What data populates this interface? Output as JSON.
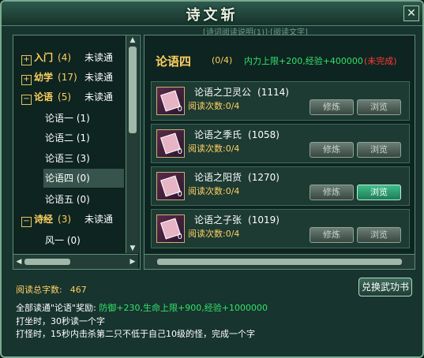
{
  "window": {
    "title": "诗文斩",
    "subtitle": "[诗词阅读说明(1)]·[阅读文字]"
  },
  "left": {
    "categories": [
      {
        "label": "入门",
        "count": "(4)",
        "status": "未读通",
        "expanded": false
      },
      {
        "label": "幼学",
        "count": "(17)",
        "status": "未读通",
        "expanded": false
      },
      {
        "label": "论语",
        "count": "(5)",
        "status": "未读通",
        "expanded": true
      },
      {
        "label": "诗经",
        "count": "(3)",
        "status": "未读通",
        "expanded": true
      }
    ],
    "subitems_lunyu": [
      {
        "label": "论语一",
        "count": "(1)"
      },
      {
        "label": "论语二",
        "count": "(1)"
      },
      {
        "label": "论语三",
        "count": "(3)"
      },
      {
        "label": "论语四",
        "count": "(0)"
      },
      {
        "label": "论语五",
        "count": "(0)"
      }
    ],
    "subitems_shijing": [
      {
        "label": "风一",
        "count": "(0)"
      }
    ]
  },
  "right": {
    "title": "论语四",
    "progress": "(0/4)",
    "reward": "内力上限+200,经验+400000",
    "status": "(未完成)",
    "items": [
      {
        "name": "论语之卫灵公",
        "id": "(1114)",
        "read": "阅读次数:0/4",
        "count": "0",
        "practice": "修炼",
        "browse": "浏览"
      },
      {
        "name": "论语之季氏",
        "id": "(1058)",
        "read": "阅读次数:0/4",
        "count": "0",
        "practice": "修炼",
        "browse": "浏览"
      },
      {
        "name": "论语之阳货",
        "id": "(1270)",
        "read": "阅读次数:0/4",
        "count": "0",
        "practice": "修炼",
        "browse": "浏览"
      },
      {
        "name": "论语之子张",
        "id": "(1019)",
        "read": "阅读次数:0/4",
        "count": "0",
        "practice": "修炼",
        "browse": "浏览"
      }
    ]
  },
  "bottom": {
    "total_label": "阅读总字数:",
    "total_value": "467",
    "exchange": "兑换武功书",
    "reward_label": "全部读通\"论语\"奖励:",
    "reward_value": "防御+230,生命上限+900,经验+1000000",
    "line2": "打坐时，30秒读一个字",
    "line3": "打怪时，15秒内击杀第二只不低于自己10级的怪，完成一个字"
  }
}
